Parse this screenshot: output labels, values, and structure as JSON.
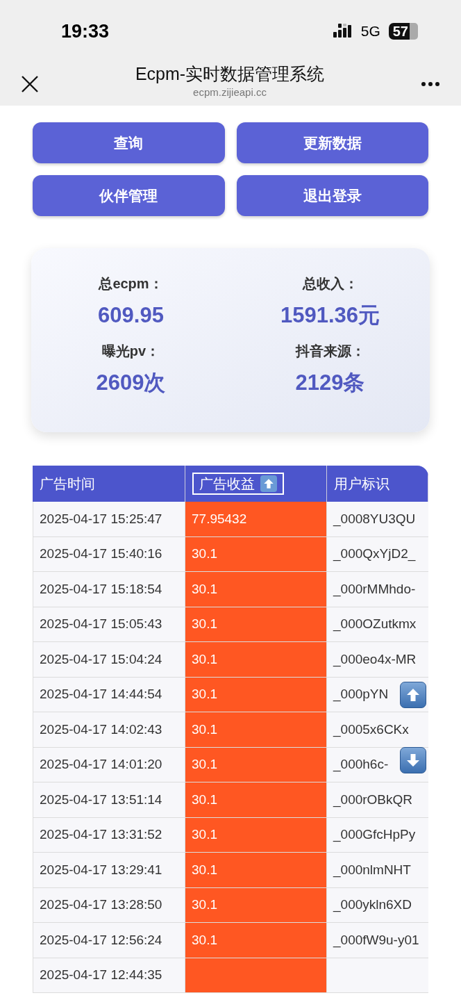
{
  "status_bar": {
    "time": "19:33",
    "network": "5G",
    "battery": "57"
  },
  "nav": {
    "title": "Ecpm-实时数据管理系统",
    "url": "ecpm.zijieapi.cc"
  },
  "buttons": [
    "查询",
    "更新数据",
    "伙伴管理",
    "退出登录"
  ],
  "stats": [
    {
      "label": "总ecpm：",
      "value": "609.95"
    },
    {
      "label": "总收入：",
      "value": "1591.36元"
    },
    {
      "label": "曝光pv：",
      "value": "2609次"
    },
    {
      "label": "抖音来源：",
      "value": "2129条"
    }
  ],
  "table": {
    "columns": [
      {
        "label": "广告时间",
        "kind": "plain"
      },
      {
        "label": "广告收益",
        "kind": "sort",
        "selected": true
      },
      {
        "label": "用户标识",
        "kind": "plain"
      }
    ],
    "rows": [
      {
        "time": "2025-04-17 15:25:47",
        "revenue": "77.95432",
        "user": "_0008YU3QU"
      },
      {
        "time": "2025-04-17 15:40:16",
        "revenue": "30.1",
        "user": "_000QxYjD2_"
      },
      {
        "time": "2025-04-17 15:18:54",
        "revenue": "30.1",
        "user": "_000rMMhdo-"
      },
      {
        "time": "2025-04-17 15:05:43",
        "revenue": "30.1",
        "user": "_000OZutkmx"
      },
      {
        "time": "2025-04-17 15:04:24",
        "revenue": "30.1",
        "user": "_000eo4x-MR"
      },
      {
        "time": "2025-04-17 14:44:54",
        "revenue": "30.1",
        "user": "_000pYN"
      },
      {
        "time": "2025-04-17 14:02:43",
        "revenue": "30.1",
        "user": "_0005x6CKx"
      },
      {
        "time": "2025-04-17 14:01:20",
        "revenue": "30.1",
        "user": "_000h6c-"
      },
      {
        "time": "2025-04-17 13:51:14",
        "revenue": "30.1",
        "user": "_000rOBkQR"
      },
      {
        "time": "2025-04-17 13:31:52",
        "revenue": "30.1",
        "user": "_000GfcHpPy"
      },
      {
        "time": "2025-04-17 13:29:41",
        "revenue": "30.1",
        "user": "_000nlmNHT"
      },
      {
        "time": "2025-04-17 13:28:50",
        "revenue": "30.1",
        "user": "_000ykln6XD"
      },
      {
        "time": "2025-04-17 12:56:24",
        "revenue": "30.1",
        "user": "_000fW9u-y01"
      },
      {
        "time": "2025-04-17 12:44:35"
      }
    ]
  }
}
